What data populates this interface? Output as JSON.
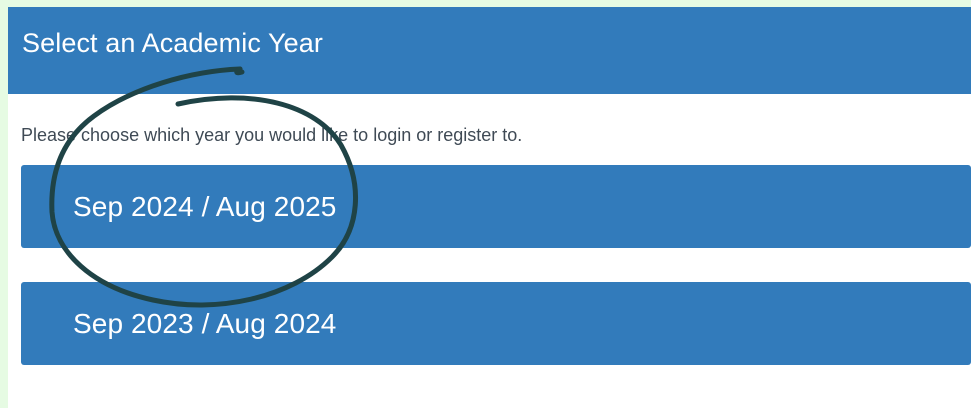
{
  "modal": {
    "title": "Select an Academic Year",
    "instruction": "Please choose which year you would like to login or register to.",
    "year_options": [
      {
        "label": "Sep 2024 / Aug 2025"
      },
      {
        "label": "Sep 2023 / Aug 2024"
      }
    ]
  },
  "annotation": {
    "type": "hand-drawn-circle",
    "color": "#1f4346",
    "target": "Sep 2024 / Aug 2025"
  },
  "colors": {
    "header_bg": "#327bbb",
    "button_bg": "#327bbb",
    "background": "#ecfbe9",
    "text": "#3f4a55"
  }
}
